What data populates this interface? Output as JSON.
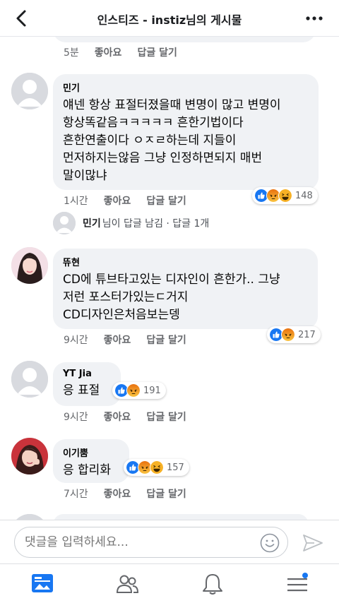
{
  "header": {
    "title": "인스티즈 - instiz님의 게시물"
  },
  "previous_comment": {
    "time": "5분",
    "like_label": "좋아요",
    "reply_label": "답글 달기"
  },
  "comments": [
    {
      "author": "민기",
      "text": "얘넨 항상 표절터졌을때 변명이 많고 변명이\n항상똑같음ㅋㅋㅋㅋㅋ 흔한기법이다\n흔한연출이다 ㅇㅈㄹ하는데 지들이\n먼저하지는않음 그냥 인정하면되지 매번\n말이많냐",
      "time": "1시간",
      "like_label": "좋아요",
      "reply_label": "답글 달기",
      "reaction_count": "148",
      "reactions": [
        "like-icon",
        "angry-icon",
        "haha-icon"
      ]
    },
    {
      "author": "뜌현",
      "text": "CD에 튜브타고있는 디자인이 흔한가.. 그냥\n저런 포스터가있는ㄷ거지\nCD디자인은처음보는뎅",
      "time": "9시간",
      "like_label": "좋아요",
      "reply_label": "답글 달기",
      "reaction_count": "217",
      "reactions": [
        "like-icon",
        "angry-icon"
      ]
    },
    {
      "author": "YT Jia",
      "text": "응 표절",
      "time": "9시간",
      "like_label": "좋아요",
      "reply_label": "답글 달기",
      "reaction_count": "191",
      "reactions": [
        "like-icon",
        "angry-icon"
      ]
    },
    {
      "author": "이기뿜",
      "text": "응 합리화",
      "time": "7시간",
      "like_label": "좋아요",
      "reply_label": "답글 달기",
      "reaction_count": "157",
      "reactions": [
        "like-icon",
        "angry-icon",
        "haha-icon"
      ]
    }
  ],
  "reply_summary": {
    "name": "민기",
    "text": "님이 답글 남김 · 답글 1개"
  },
  "composer": {
    "placeholder": "댓글을 입력하세요..."
  },
  "colors": {
    "like": "#1877f2",
    "angry": "#e9710f",
    "haha": "#f7b125",
    "bubble": "#f0f2f5",
    "nav_active": "#1877f2"
  },
  "bottom_nav": [
    "news-feed-icon",
    "friends-icon",
    "notifications-icon",
    "menu-icon"
  ]
}
